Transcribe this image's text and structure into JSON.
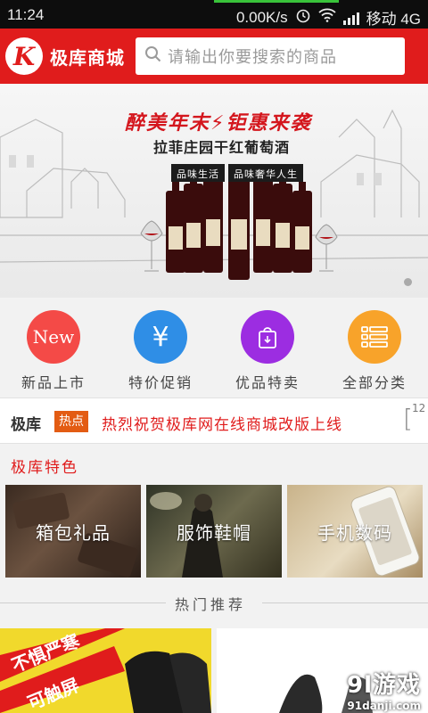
{
  "status_bar": {
    "time": "11:24",
    "speed": "0.00K/s",
    "carrier": "移动 4G"
  },
  "header": {
    "brand": "极库商城",
    "logo_letter": "K",
    "search_placeholder": "请输出你要搜索的商品"
  },
  "banner": {
    "headline": "醉美年末⚡钜惠来袭",
    "subtitle": "拉菲庄园干红葡萄酒",
    "tag1": "品味生活",
    "tag2": "品味奢华人生"
  },
  "categories": [
    {
      "label": "新品上市",
      "icon": "new-icon",
      "icon_text": "New",
      "color": "#f44a47"
    },
    {
      "label": "特价促销",
      "icon": "yen-icon",
      "icon_text": "¥",
      "color": "#2f8ee6"
    },
    {
      "label": "优品特卖",
      "icon": "shopping-bag-icon",
      "icon_text": "",
      "color": "#9c2de1"
    },
    {
      "label": "全部分类",
      "icon": "list-icon",
      "icon_text": "",
      "color": "#f8a32a"
    }
  ],
  "news": {
    "brand": "极库",
    "hot_tag": "热点",
    "headline": "热烈祝贺极库网在线商城改版上线",
    "counter": "12"
  },
  "features": {
    "title": "极库特色",
    "items": [
      {
        "label": "箱包礼品"
      },
      {
        "label": "服饰鞋帽"
      },
      {
        "label": "手机数码"
      }
    ]
  },
  "recommend": {
    "title": "热门推荐",
    "promo_text1": "不惧严寒",
    "promo_text2": "可触屏"
  },
  "watermark": {
    "logo": "9l游戏",
    "url": "91danji.com"
  }
}
